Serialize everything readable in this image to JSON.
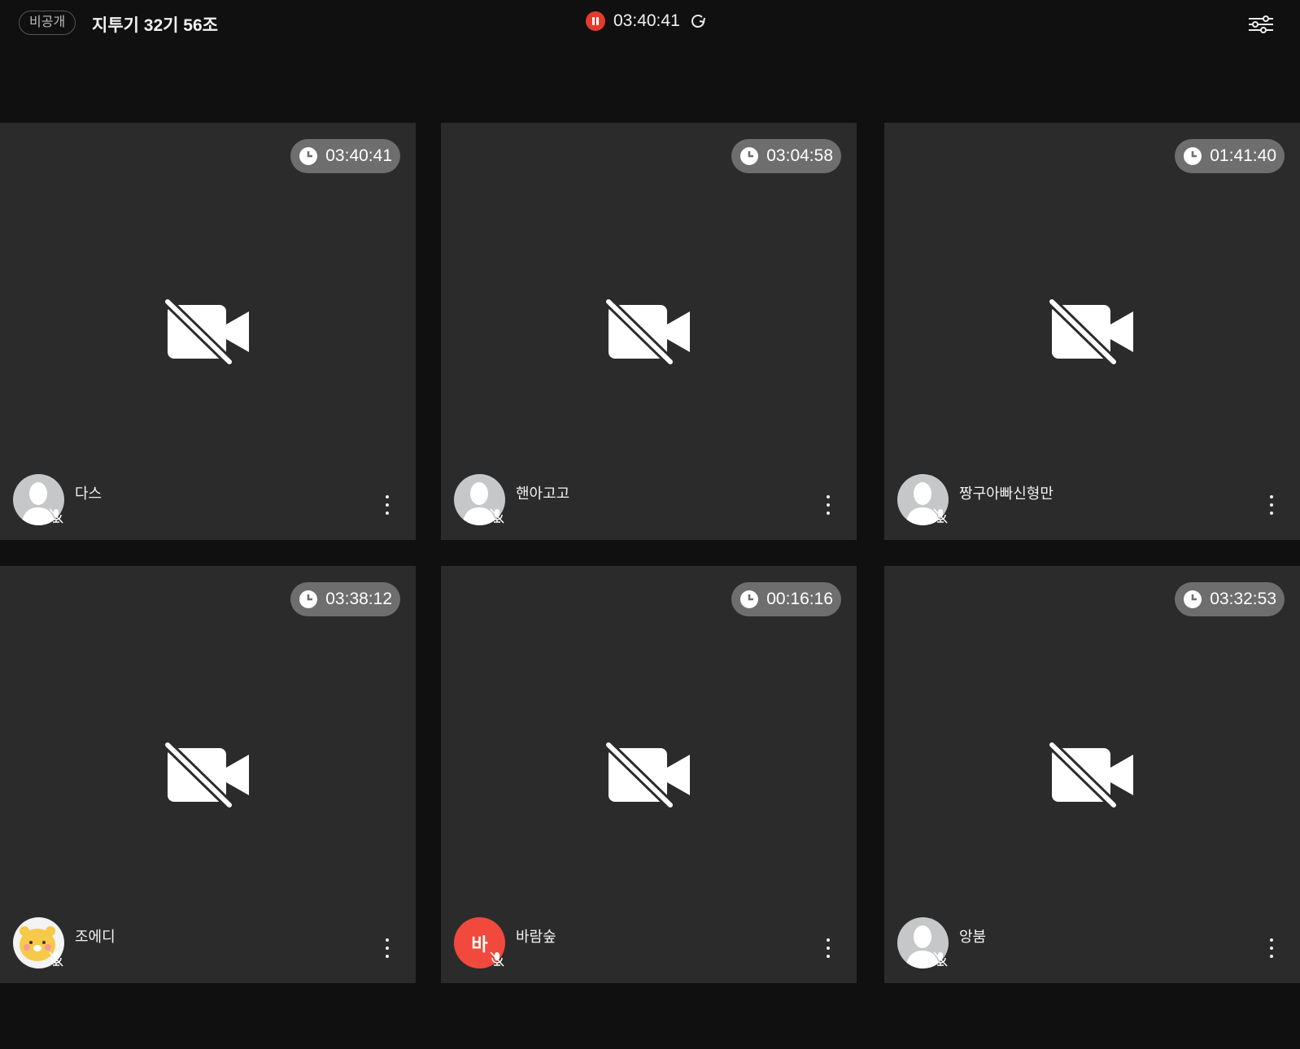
{
  "header": {
    "privacy_label": "비공개",
    "room_title": "지투기 32기 56조",
    "recording_time": "03:40:41",
    "recording_color": "#e53b2f"
  },
  "participants": [
    {
      "name": "다스",
      "time": "03:40:41",
      "avatar": "default",
      "mic": "muted",
      "camera": "off"
    },
    {
      "name": "핸아고고",
      "time": "03:04:58",
      "avatar": "default",
      "mic": "muted",
      "camera": "off"
    },
    {
      "name": "짱구아빠신형만",
      "time": "01:41:40",
      "avatar": "default",
      "mic": "muted",
      "camera": "off"
    },
    {
      "name": "조에디",
      "time": "03:38:12",
      "avatar": "character",
      "mic": "muted",
      "camera": "off"
    },
    {
      "name": "바람숲",
      "time": "00:16:16",
      "avatar": "initial",
      "initial": "바",
      "avatar_color": "#f2493d",
      "mic": "muted",
      "camera": "off"
    },
    {
      "name": "앙붐",
      "time": "03:32:53",
      "avatar": "default",
      "mic": "muted",
      "camera": "off"
    }
  ]
}
